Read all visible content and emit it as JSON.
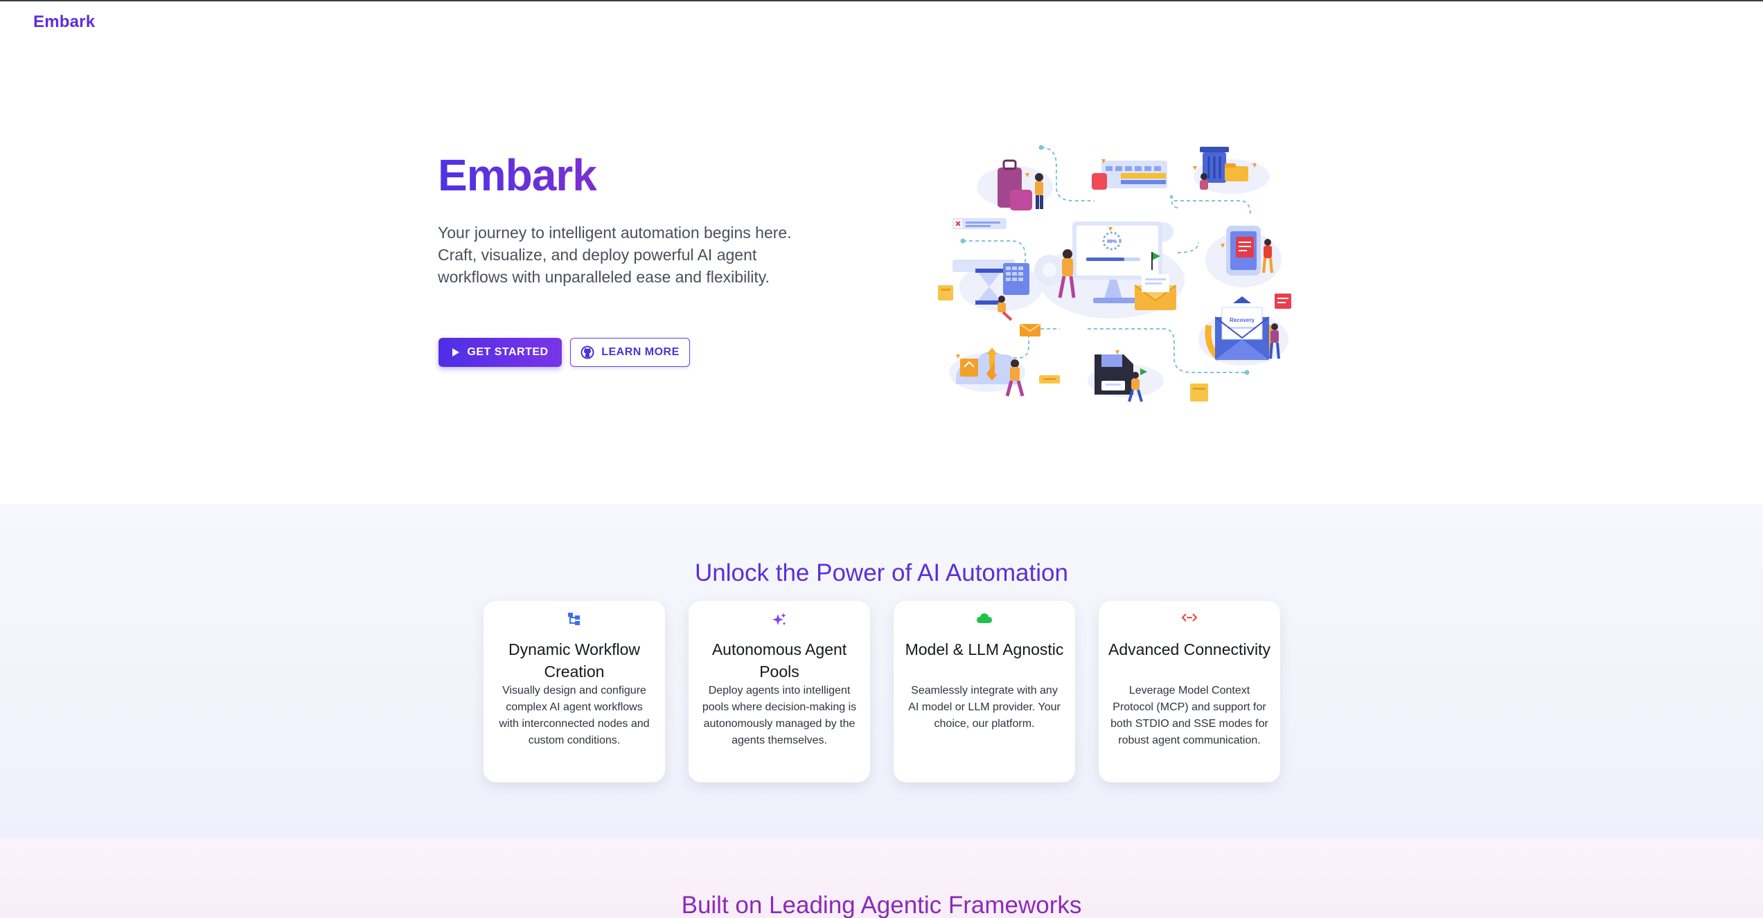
{
  "nav": {
    "brand": "Embark"
  },
  "hero": {
    "title": "Embark",
    "description": "Your journey to intelligent automation begins here. Craft, visualize, and deploy powerful AI agent workflows with unparalleled ease and flexibility.",
    "primary_button": {
      "label": "GET STARTED",
      "icon": "play-icon"
    },
    "secondary_button": {
      "label": "LEARN MORE",
      "icon": "github-icon"
    },
    "illustration_labels": {
      "progress": "99%",
      "recovery": "Recovery"
    }
  },
  "features": {
    "title": "Unlock the Power of AI Automation",
    "cards": [
      {
        "icon": "workflow-icon",
        "icon_color": "#3b6ef0",
        "title": "Dynamic Workflow Creation",
        "text": "Visually design and configure complex AI agent workflows with interconnected nodes and custom conditions."
      },
      {
        "icon": "sparkles-icon",
        "icon_color": "#8b3ff0",
        "title": "Autonomous Agent Pools",
        "text": "Deploy agents into intelligent pools where decision-making is autonomously managed by the agents themselves."
      },
      {
        "icon": "cloud-icon",
        "icon_color": "#1ec24a",
        "title": "Model & LLM Agnostic",
        "text": "Seamlessly integrate with any AI model or LLM provider. Your choice, our platform."
      },
      {
        "icon": "code-connection-icon",
        "icon_color": "#e8452f",
        "title": "Advanced Connectivity",
        "text": "Leverage Model Context Protocol (MCP) and support for both STDIO and SSE modes for robust agent communication."
      }
    ]
  },
  "frameworks": {
    "title": "Built on Leading Agentic Frameworks"
  },
  "colors": {
    "brand": "#5b2ee0",
    "accent_gradient_end": "#7a35e8",
    "frameworks_title": "#8a2bb8"
  }
}
